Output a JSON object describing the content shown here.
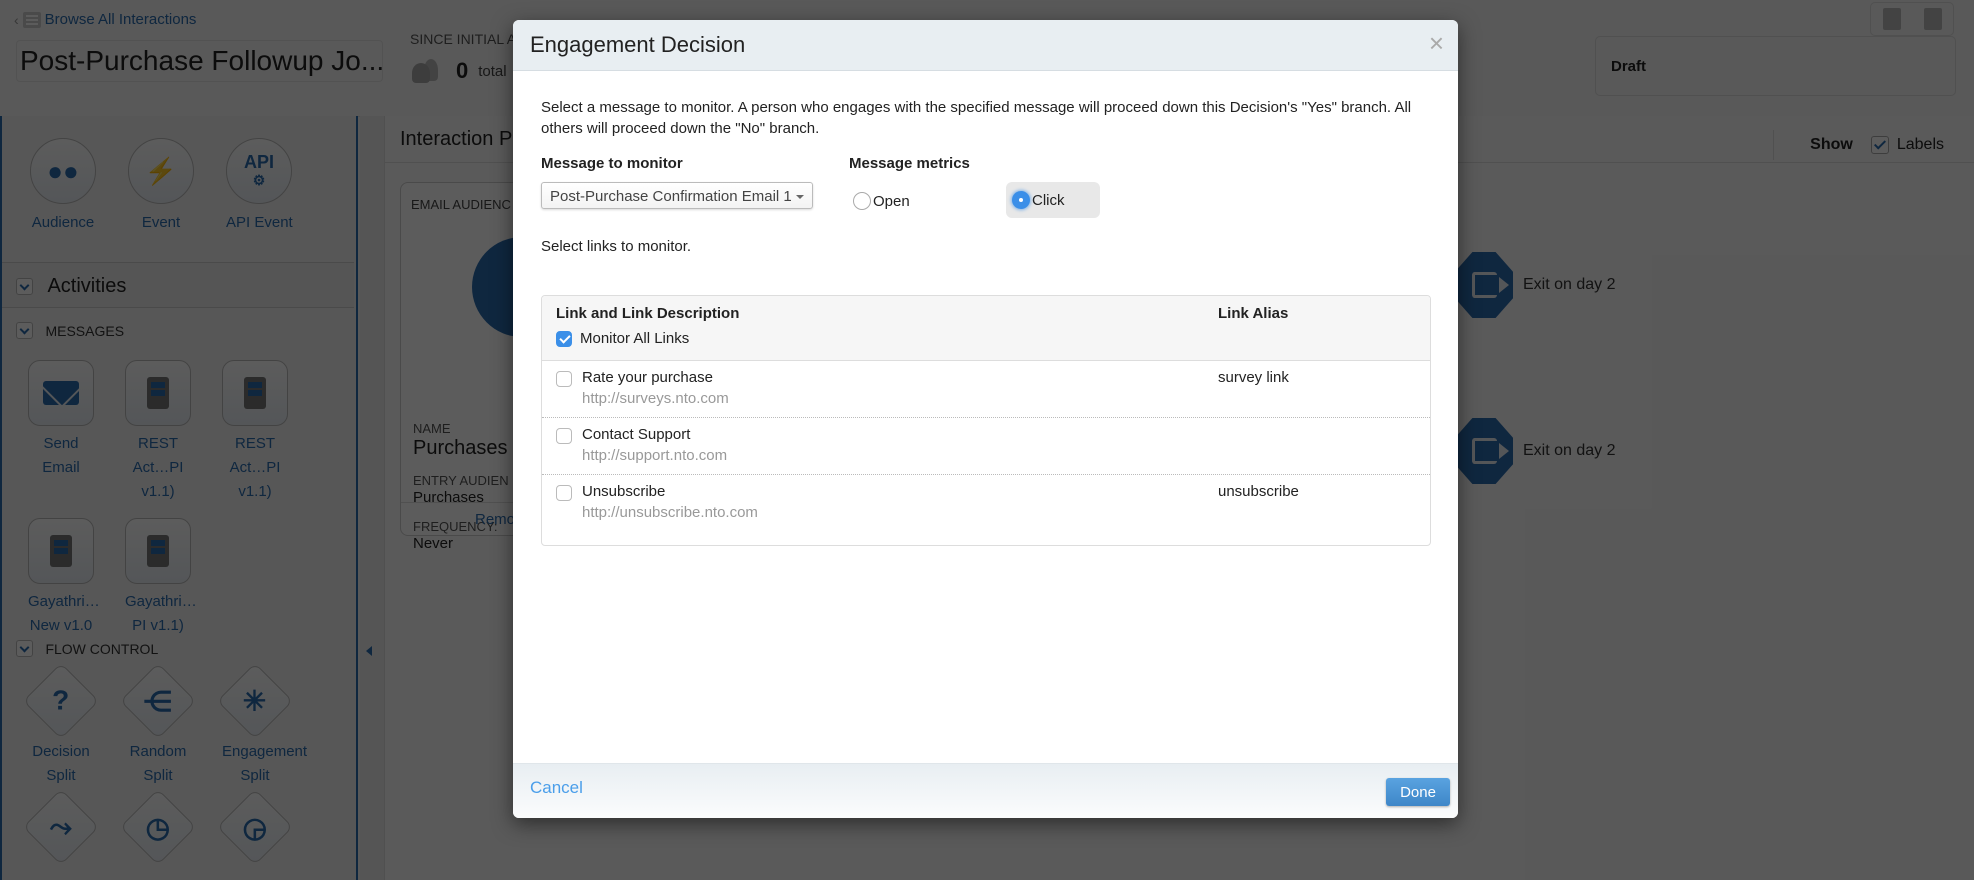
{
  "header": {
    "browse_link": "Browse All Interactions",
    "journey_title": "Post-Purchase Followup Jo...",
    "since_label": "SINCE INITIAL A",
    "total_count": "0",
    "total_label": "total",
    "status": "Draft",
    "tools": [
      "copy-icon",
      "trash-icon"
    ]
  },
  "sidebar": {
    "entry_sources": [
      {
        "label": "Audience",
        "icon": "audience-icon"
      },
      {
        "label": "Event",
        "icon": "lightning-icon"
      },
      {
        "label": "API Event",
        "icon": "api-gear-icon"
      }
    ],
    "activities_title": "Activities",
    "messages_title": "MESSAGES",
    "messages": [
      {
        "line1": "Send",
        "line2": "Email",
        "line3": "",
        "icon": "email-icon"
      },
      {
        "line1": "REST",
        "line2": "Act…PI",
        "line3": "v1.1)",
        "icon": "mobile-icon"
      },
      {
        "line1": "REST",
        "line2": "Act…PI",
        "line3": "v1.1)",
        "icon": "mobile-icon"
      },
      {
        "line1": "Gayathri…",
        "line2": "New v1.0",
        "line3": "",
        "icon": "mobile-icon"
      },
      {
        "line1": "Gayathri…",
        "line2": "PI v1.1)",
        "line3": "",
        "icon": "mobile-icon"
      }
    ],
    "flow_title": "FLOW CONTROL",
    "flow": [
      {
        "line1": "Decision",
        "line2": "Split",
        "icon": "question-icon",
        "glyph": "?"
      },
      {
        "line1": "Random",
        "line2": "Split",
        "icon": "random-split-icon",
        "glyph": "⋲"
      },
      {
        "line1": "Engagement",
        "line2": "Split",
        "icon": "click-cursor-icon",
        "glyph": "✳"
      },
      {
        "line1": "",
        "line2": "",
        "icon": "path-join-icon",
        "glyph": "⤳"
      },
      {
        "line1": "",
        "line2": "",
        "icon": "clock-icon",
        "glyph": "◷"
      },
      {
        "line1": "",
        "line2": "",
        "icon": "clock-lightning-icon",
        "glyph": "◶"
      }
    ]
  },
  "canvas": {
    "title": "Interaction Pl",
    "show_label": "Show",
    "labels_label": "Labels",
    "labels_checked": true,
    "entry_card": {
      "caption": "EMAIL AUDIENC",
      "name_key": "NAME",
      "name_value": "Purchases",
      "entry_key": "ENTRY AUDIEN",
      "entry_value": "Purchases",
      "freq_key": "FREQUENCY:",
      "freq_value": "Never",
      "remove_label": "Remo"
    },
    "exits": [
      {
        "label": "Exit on day 2"
      },
      {
        "label": "Exit on day 2"
      }
    ]
  },
  "modal": {
    "title": "Engagement Decision",
    "close_glyph": "×",
    "intro": "Select a message to monitor. A person who engages with the specified message will proceed down this Decision's \"Yes\" branch. All others will proceed down the \"No\" branch.",
    "message_label": "Message to monitor",
    "message_value": "Post-Purchase Confirmation Email 1",
    "metrics_label": "Message metrics",
    "metrics": [
      {
        "label": "Open",
        "selected": false
      },
      {
        "label": "Click",
        "selected": true
      }
    ],
    "links_note": "Select links to monitor.",
    "links_table": {
      "col1": "Link and Link Description",
      "col2": "Link Alias",
      "monitor_all_label": "Monitor All Links",
      "monitor_all_checked": true,
      "rows": [
        {
          "name": "Rate your purchase",
          "url": "http://surveys.nto.com",
          "alias": "survey link",
          "checked": false
        },
        {
          "name": "Contact Support",
          "url": "http://support.nto.com",
          "alias": "",
          "checked": false
        },
        {
          "name": "Unsubscribe",
          "url": "http://unsubscribe.nto.com",
          "alias": "unsubscribe",
          "checked": false
        }
      ]
    },
    "cancel_label": "Cancel",
    "done_label": "Done"
  },
  "colors": {
    "accent": "#2b6cb0",
    "radio_selected": "#3b8fe8",
    "done_button": "#4a92d3"
  }
}
